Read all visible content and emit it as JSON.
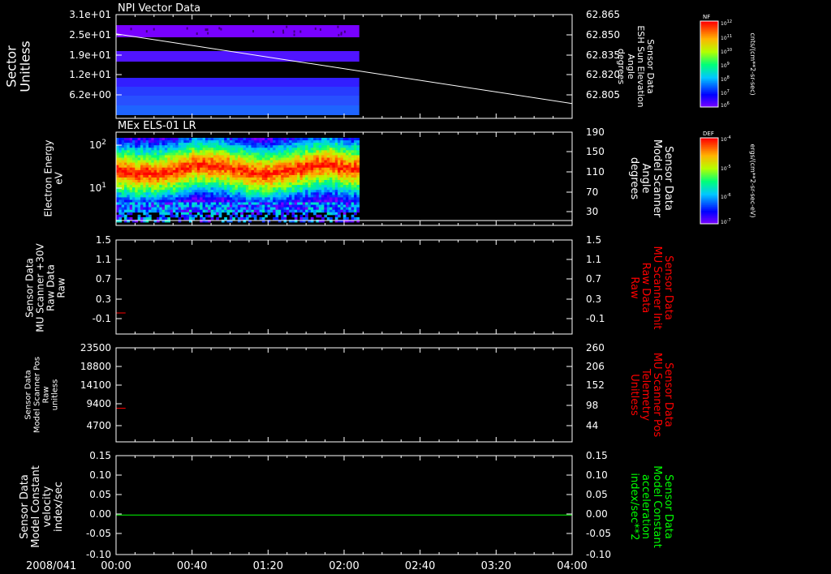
{
  "date_label": "2008/041",
  "time_ticks": [
    "00:00",
    "00:40",
    "01:20",
    "02:00",
    "02:40",
    "03:20",
    "04:00"
  ],
  "colors": {
    "background": "#000000",
    "axis": "#ffffff",
    "trace_red": "#ff0000",
    "trace_green": "#00ff00"
  },
  "chart_data": [
    {
      "type": "heatmap",
      "title": "NPI Vector Data",
      "ylabel": [
        "Sector",
        "Unitless"
      ],
      "ytick_labels": [
        "3.1e+01",
        "2.5e+01",
        "1.9e+01",
        "1.2e+01",
        "6.2e+00"
      ],
      "right_ylabel": [
        "Sensor Data",
        "ESH Sun Elevation",
        "Angle",
        "degrees"
      ],
      "right_ytick_labels": [
        "62.865",
        "62.850",
        "62.835",
        "62.820",
        "62.805"
      ],
      "right_ylim": [
        62.795,
        62.865
      ],
      "overlay_line": {
        "x": [
          "00:00",
          "04:00"
        ],
        "y": [
          62.852,
          62.805
        ]
      },
      "data_extent_x": [
        "00:00",
        "02:08"
      ],
      "colorbar": {
        "label": "NF",
        "units": "cnts/(cm**2-sr-sec)",
        "tick_labels": [
          "10¹²",
          "10¹¹",
          "10¹⁰",
          "10⁹",
          "10⁸",
          "10⁷",
          "10⁶"
        ]
      }
    },
    {
      "type": "heatmap",
      "title": "MEx ELS-01 LR",
      "ylabel": [
        "Electron Energy",
        "eV"
      ],
      "ytick_labels": [
        "10²",
        "10¹"
      ],
      "right_ylabel": [
        "Sensor Data",
        "Model Scanner",
        "Angle",
        "degrees"
      ],
      "right_ytick_labels": [
        "190",
        "150",
        "110",
        "70",
        "30"
      ],
      "right_ylim": [
        0,
        190
      ],
      "data_extent_x": [
        "00:00",
        "02:08"
      ],
      "colorbar": {
        "label": "DEF",
        "units": "ergs/(cm**2-sr-sec-eV)",
        "tick_labels": [
          "10⁻⁴",
          "10⁻⁵",
          "10⁻⁶",
          "10⁻⁷"
        ]
      }
    },
    {
      "type": "line",
      "ylabel": [
        "Sensor Data",
        "MU Scanner +30V",
        "Raw Data",
        "Raw"
      ],
      "ytick_labels": [
        "1.5",
        "1.1",
        "0.7",
        "0.3",
        "-0.1"
      ],
      "ylim": [
        -0.3,
        1.5
      ],
      "right_ylabel": [
        "Sensor Data",
        "MU Scanner Init",
        "Raw Data",
        "Raw"
      ],
      "right_ytick_labels": [
        "1.5",
        "1.1",
        "0.7",
        "0.3",
        "-0.1"
      ],
      "series": [
        {
          "x": [
            "00:00",
            "00:05"
          ],
          "y": [
            0.0,
            0.0
          ],
          "color": "#ff0000"
        }
      ]
    },
    {
      "type": "line",
      "ylabel": [
        "Sensor Data",
        "Model Scanner Pos",
        "Raw",
        "unitless"
      ],
      "ytick_labels": [
        "23500",
        "18800",
        "14100",
        "9400",
        "4700"
      ],
      "ylim": [
        0,
        23500
      ],
      "right_ylabel": [
        "Sensor Data",
        "MU Scanner Pos",
        "Telemetry",
        "Unitless"
      ],
      "right_ytick_labels": [
        "260",
        "206",
        "152",
        "98",
        "44"
      ],
      "series": [
        {
          "x": [
            "00:00",
            "00:05"
          ],
          "y": [
            8400,
            8400
          ],
          "color": "#ff0000"
        }
      ]
    },
    {
      "type": "line",
      "ylabel": [
        "Sensor Data",
        "Model Constant",
        "velocity",
        "index/sec"
      ],
      "ytick_labels": [
        "0.15",
        "0.10",
        "0.05",
        "0.00",
        "-0.05",
        "-0.10"
      ],
      "ylim": [
        -0.1,
        0.15
      ],
      "right_ylabel": [
        "Sensor Data",
        "Model Constant",
        "acceleration",
        "index/sec**2"
      ],
      "right_ytick_labels": [
        "0.15",
        "0.10",
        "0.05",
        "0.00",
        "-0.05",
        "-0.10"
      ],
      "series": [
        {
          "x": [
            "00:00",
            "04:00"
          ],
          "y": [
            0.0,
            0.0
          ],
          "color": "#00ff00"
        }
      ]
    }
  ]
}
